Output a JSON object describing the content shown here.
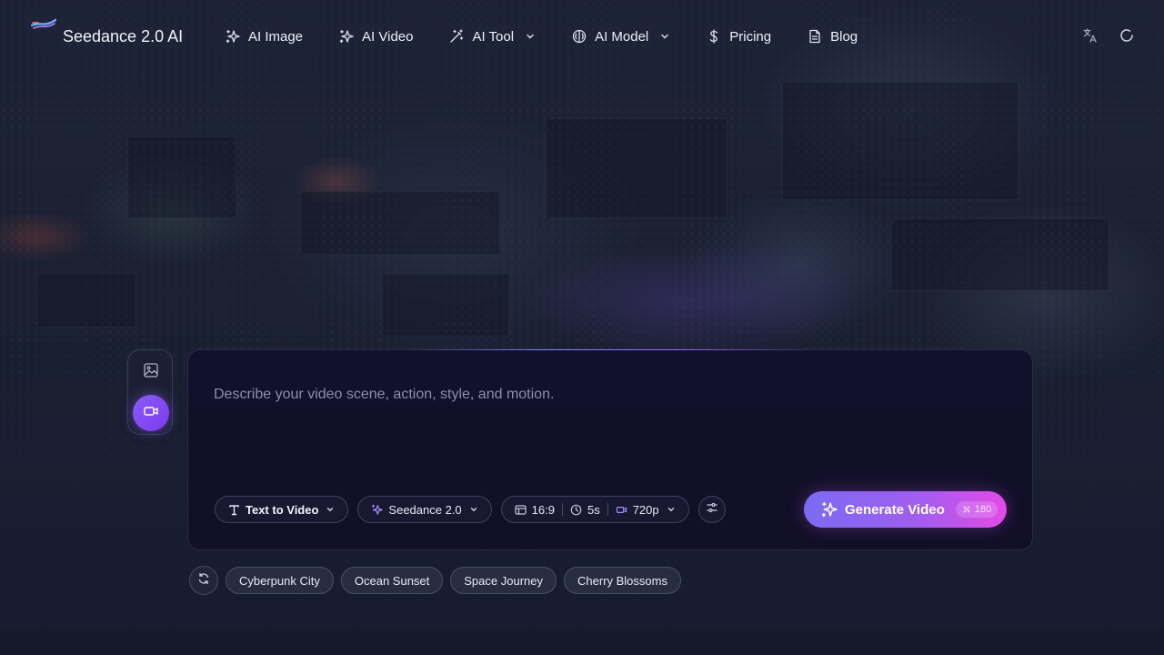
{
  "app": {
    "brand": "Seedance 2.0 AI"
  },
  "nav": {
    "items": [
      {
        "label": "AI Image",
        "icon": "sparkles-icon"
      },
      {
        "label": "AI Video",
        "icon": "sparkles-icon"
      },
      {
        "label": "AI Tool",
        "icon": "magic-wand-icon",
        "dropdown": true
      },
      {
        "label": "AI Model",
        "icon": "brain-icon",
        "dropdown": true
      },
      {
        "label": "Pricing",
        "icon": "dollar-icon"
      },
      {
        "label": "Blog",
        "icon": "document-icon"
      }
    ],
    "right_icons": [
      "translate-icon",
      "loading-spinner-icon"
    ]
  },
  "mode_switch": {
    "options": [
      "image-mode",
      "video-mode"
    ],
    "active": "video-mode"
  },
  "prompt": {
    "placeholder": "Describe your video scene, action, style, and motion."
  },
  "controls": {
    "mode": "Text to Video",
    "model": "Seedance 2.0",
    "aspect_ratio": "16:9",
    "duration": "5s",
    "resolution": "720p"
  },
  "generate": {
    "label": "Generate Video",
    "credits": "180"
  },
  "suggestions": [
    "Cyberpunk City",
    "Ocean Sunset",
    "Space Journey",
    "Cherry Blossoms"
  ],
  "colors": {
    "accent_start": "#7b6bf2",
    "accent_end": "#e34ae6",
    "active_mode": "#8b5cf6"
  }
}
